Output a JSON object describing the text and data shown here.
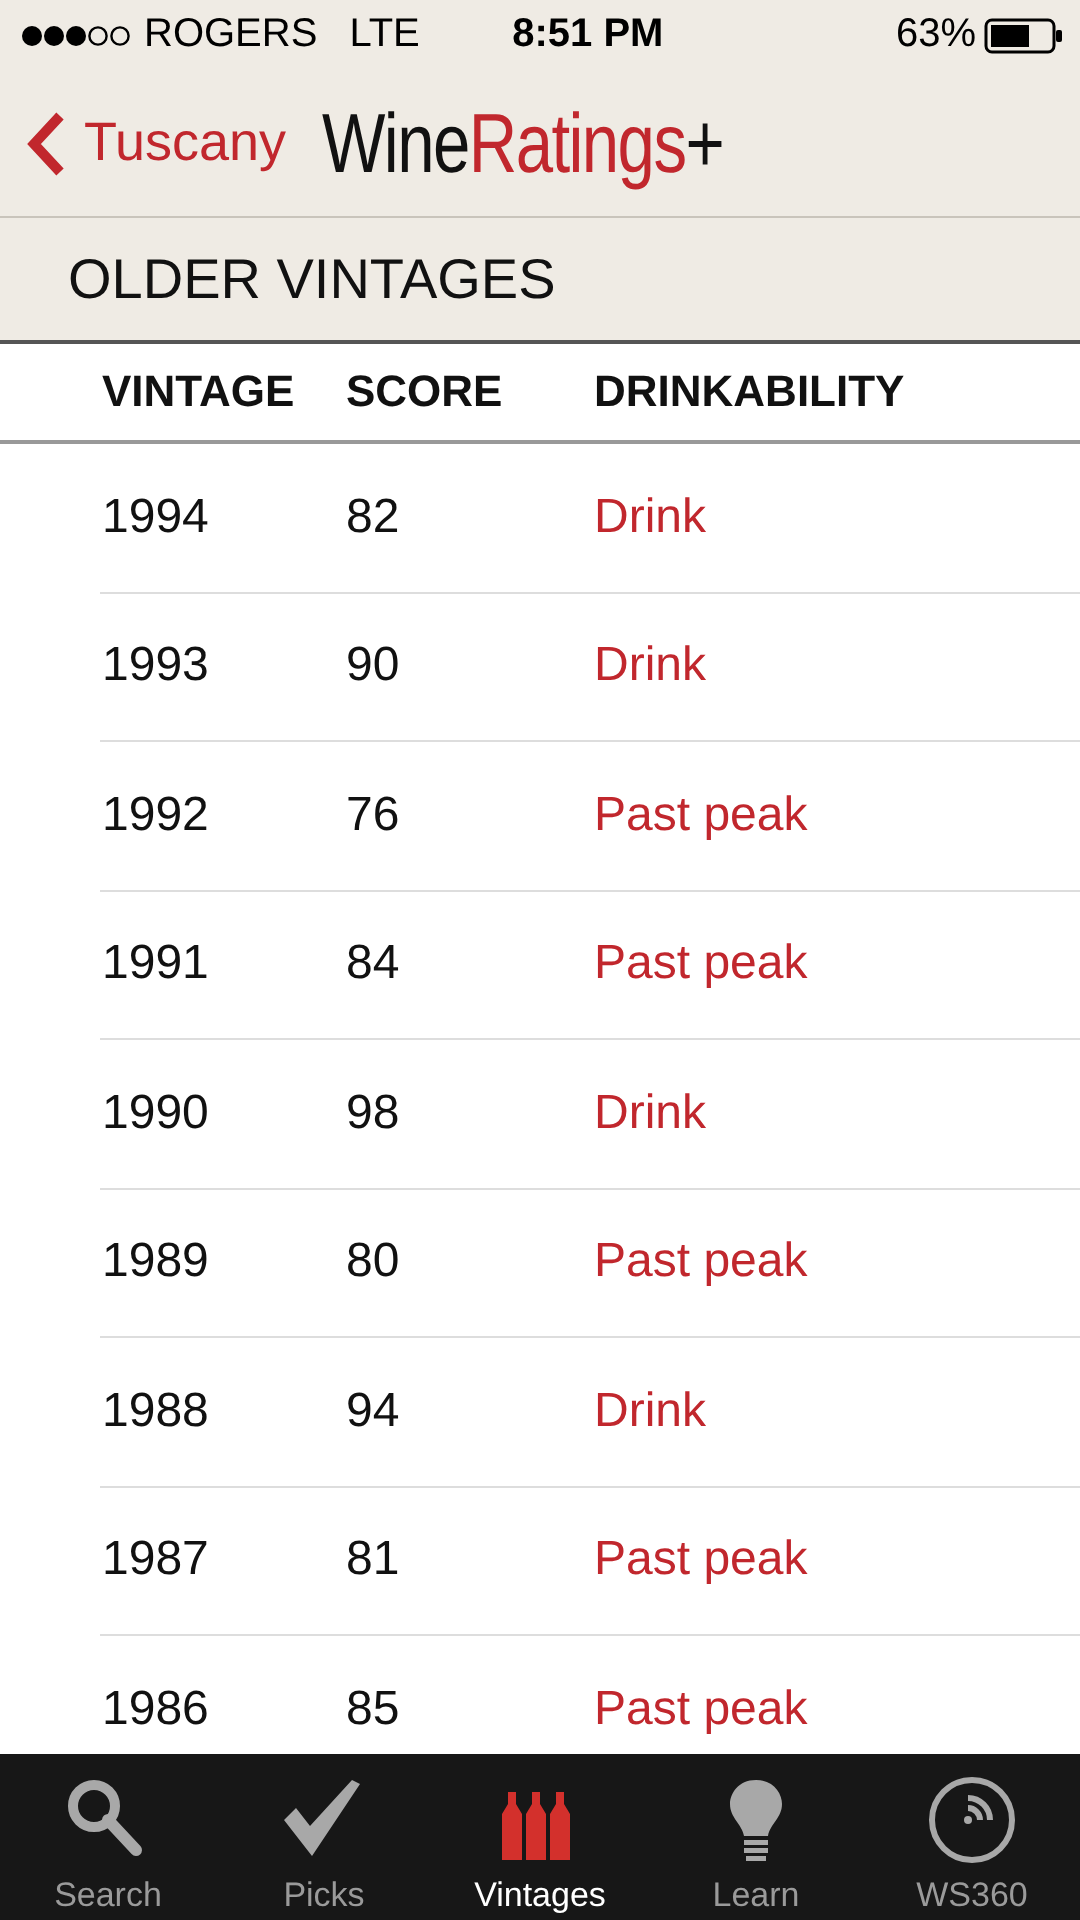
{
  "status_bar": {
    "carrier": "ROGERS",
    "network": "LTE",
    "time": "8:51 PM",
    "battery": "63%"
  },
  "nav": {
    "back": "Tuscany",
    "logo": [
      {
        "text": "Wine",
        "kind": "plain"
      },
      {
        "text": "Ratings",
        "kind": "accent"
      },
      {
        "text": "+",
        "kind": "plain"
      }
    ]
  },
  "section_title": "OLDER VINTAGES",
  "table": {
    "columns": [
      "VINTAGE",
      "SCORE",
      "DRINKABILITY"
    ],
    "rows": [
      {
        "vintage": "1994",
        "score": "82",
        "drinkability": "Drink"
      },
      {
        "vintage": "1993",
        "score": "90",
        "drinkability": "Drink"
      },
      {
        "vintage": "1992",
        "score": "76",
        "drinkability": "Past peak"
      },
      {
        "vintage": "1991",
        "score": "84",
        "drinkability": "Past peak"
      },
      {
        "vintage": "1990",
        "score": "98",
        "drinkability": "Drink"
      },
      {
        "vintage": "1989",
        "score": "80",
        "drinkability": "Past peak"
      },
      {
        "vintage": "1988",
        "score": "94",
        "drinkability": "Drink"
      },
      {
        "vintage": "1987",
        "score": "81",
        "drinkability": "Past peak"
      },
      {
        "vintage": "1986",
        "score": "85",
        "drinkability": "Past peak"
      }
    ]
  },
  "tab_bar": [
    {
      "label": "Search",
      "kind": "search",
      "selected": false
    },
    {
      "label": "Picks",
      "kind": "picks",
      "selected": false
    },
    {
      "label": "Vintages",
      "kind": "vintages",
      "selected": true
    },
    {
      "label": "Learn",
      "kind": "learn",
      "selected": false
    },
    {
      "label": "WS360",
      "kind": "ws360",
      "selected": false
    }
  ]
}
